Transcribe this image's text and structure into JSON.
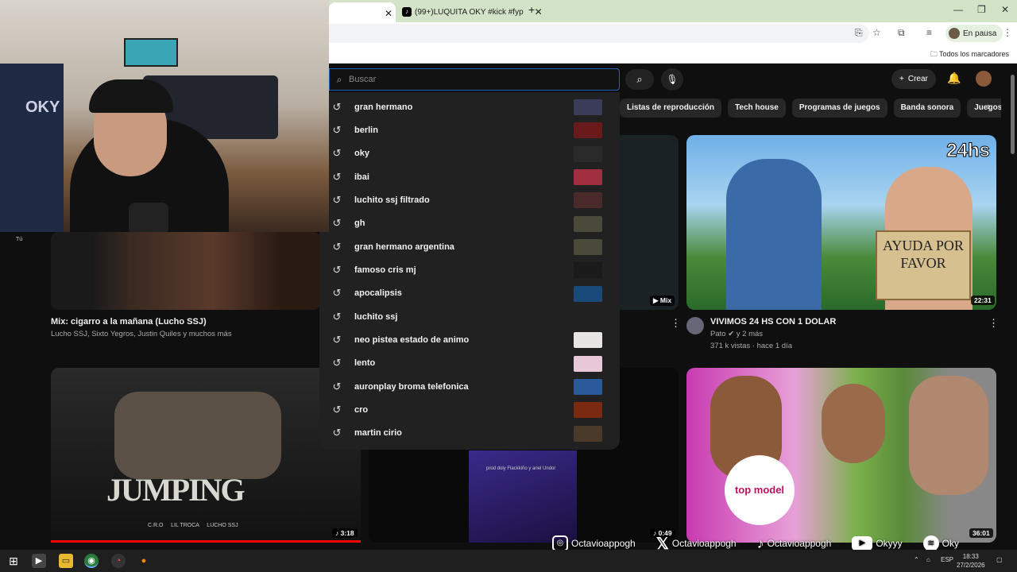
{
  "webcam": {
    "overlay_text": "OKY"
  },
  "browser": {
    "tabs": [
      {
        "label": ""
      },
      {
        "label": "(99+)LUQUITA OKY #kick #fyp"
      }
    ],
    "profile_status": "En pausa",
    "bookmarks_label": "Todos los marcadores"
  },
  "youtube": {
    "search_placeholder": "Buscar",
    "create_label": "Crear",
    "chips": [
      "Listas de reproducción",
      "Tech house",
      "Programas de juegos",
      "Banda sonora",
      "Juegos de ave"
    ],
    "suggestions": [
      {
        "text": "gran hermano",
        "color": "#3b3b5a"
      },
      {
        "text": "berlin",
        "color": "#6a1a1a"
      },
      {
        "text": "oky",
        "color": "#2a2a2a"
      },
      {
        "text": "ibai",
        "color": "#a03040"
      },
      {
        "text": "luchito ssj filtrado",
        "color": "#4a2a2a"
      },
      {
        "text": "gh",
        "color": "#4a4a3a"
      },
      {
        "text": "gran hermano argentina",
        "color": "#4a4a3a"
      },
      {
        "text": "famoso cris mj",
        "color": "#1a1a1a"
      },
      {
        "text": "apocalipsis",
        "color": "#1a4a7a"
      },
      {
        "text": "luchito ssj",
        "color": "#212121"
      },
      {
        "text": "neo pistea estado de animo",
        "color": "#e8e4e4"
      },
      {
        "text": "lento",
        "color": "#e8c8d8"
      },
      {
        "text": "auronplay broma telefonica",
        "color": "#2a5a9a"
      },
      {
        "text": "cro",
        "color": "#7a2a10"
      },
      {
        "text": "martin cirio",
        "color": "#4a3a2a"
      }
    ],
    "videos": [
      {
        "title": "Mix: cigarro a la mañana (Lucho SSJ)",
        "meta": "Lucho SSJ, Sixto Yegros, Justin Quiles y muchos más"
      },
      {
        "badge": "Mix"
      },
      {
        "title": "VIVIMOS 24 HS CON 1 DOLAR",
        "channel": "Pato",
        "age_label": "y 2 más",
        "meta": "371 k vistas · hace 1 día",
        "duration": "22:31",
        "thumb_text": "24hs",
        "sign_text": "AYUDA POR FAVOR"
      },
      {
        "duration": "3:18",
        "thumb_text": "JUMPING",
        "credits": "C.R.O     LIL TROCA     LUCHO SSJ"
      },
      {
        "duration": "0:49",
        "overlay": "prod doly Flackkiño y ariel Undor"
      },
      {
        "duration": "36:01",
        "thumb_text": "top model"
      }
    ],
    "sidebar_you": "Tú"
  },
  "socials": [
    {
      "icon": "instagram-icon",
      "handle": "Octavioappogh"
    },
    {
      "icon": "x-icon",
      "handle": "Octavioappogh"
    },
    {
      "icon": "tiktok-icon",
      "handle": "Octavioappogh"
    },
    {
      "icon": "youtube-icon",
      "handle": "Okyyy"
    },
    {
      "icon": "spotify-icon",
      "handle": "Oky"
    }
  ],
  "taskbar": {
    "lang": "ESP",
    "time": "18:33",
    "date": "27/2/2026"
  }
}
